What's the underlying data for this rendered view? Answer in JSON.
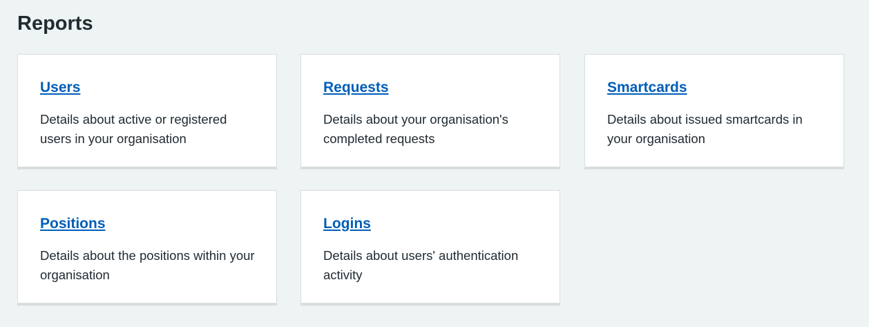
{
  "page": {
    "title": "Reports"
  },
  "cards": [
    {
      "title": "Users",
      "description": "Details about active or registered users in your organisation"
    },
    {
      "title": "Requests",
      "description": "Details about your organisation's completed requests"
    },
    {
      "title": "Smartcards",
      "description": "Details about issued smartcards in your organisation"
    },
    {
      "title": "Positions",
      "description": "Details about the positions within your organisation"
    },
    {
      "title": "Logins",
      "description": "Details about users' authentication activity"
    }
  ],
  "colors": {
    "background": "#eef3f3",
    "card": "#ffffff",
    "link": "#005eb8",
    "text": "#212b32",
    "border": "#d8dde0"
  }
}
